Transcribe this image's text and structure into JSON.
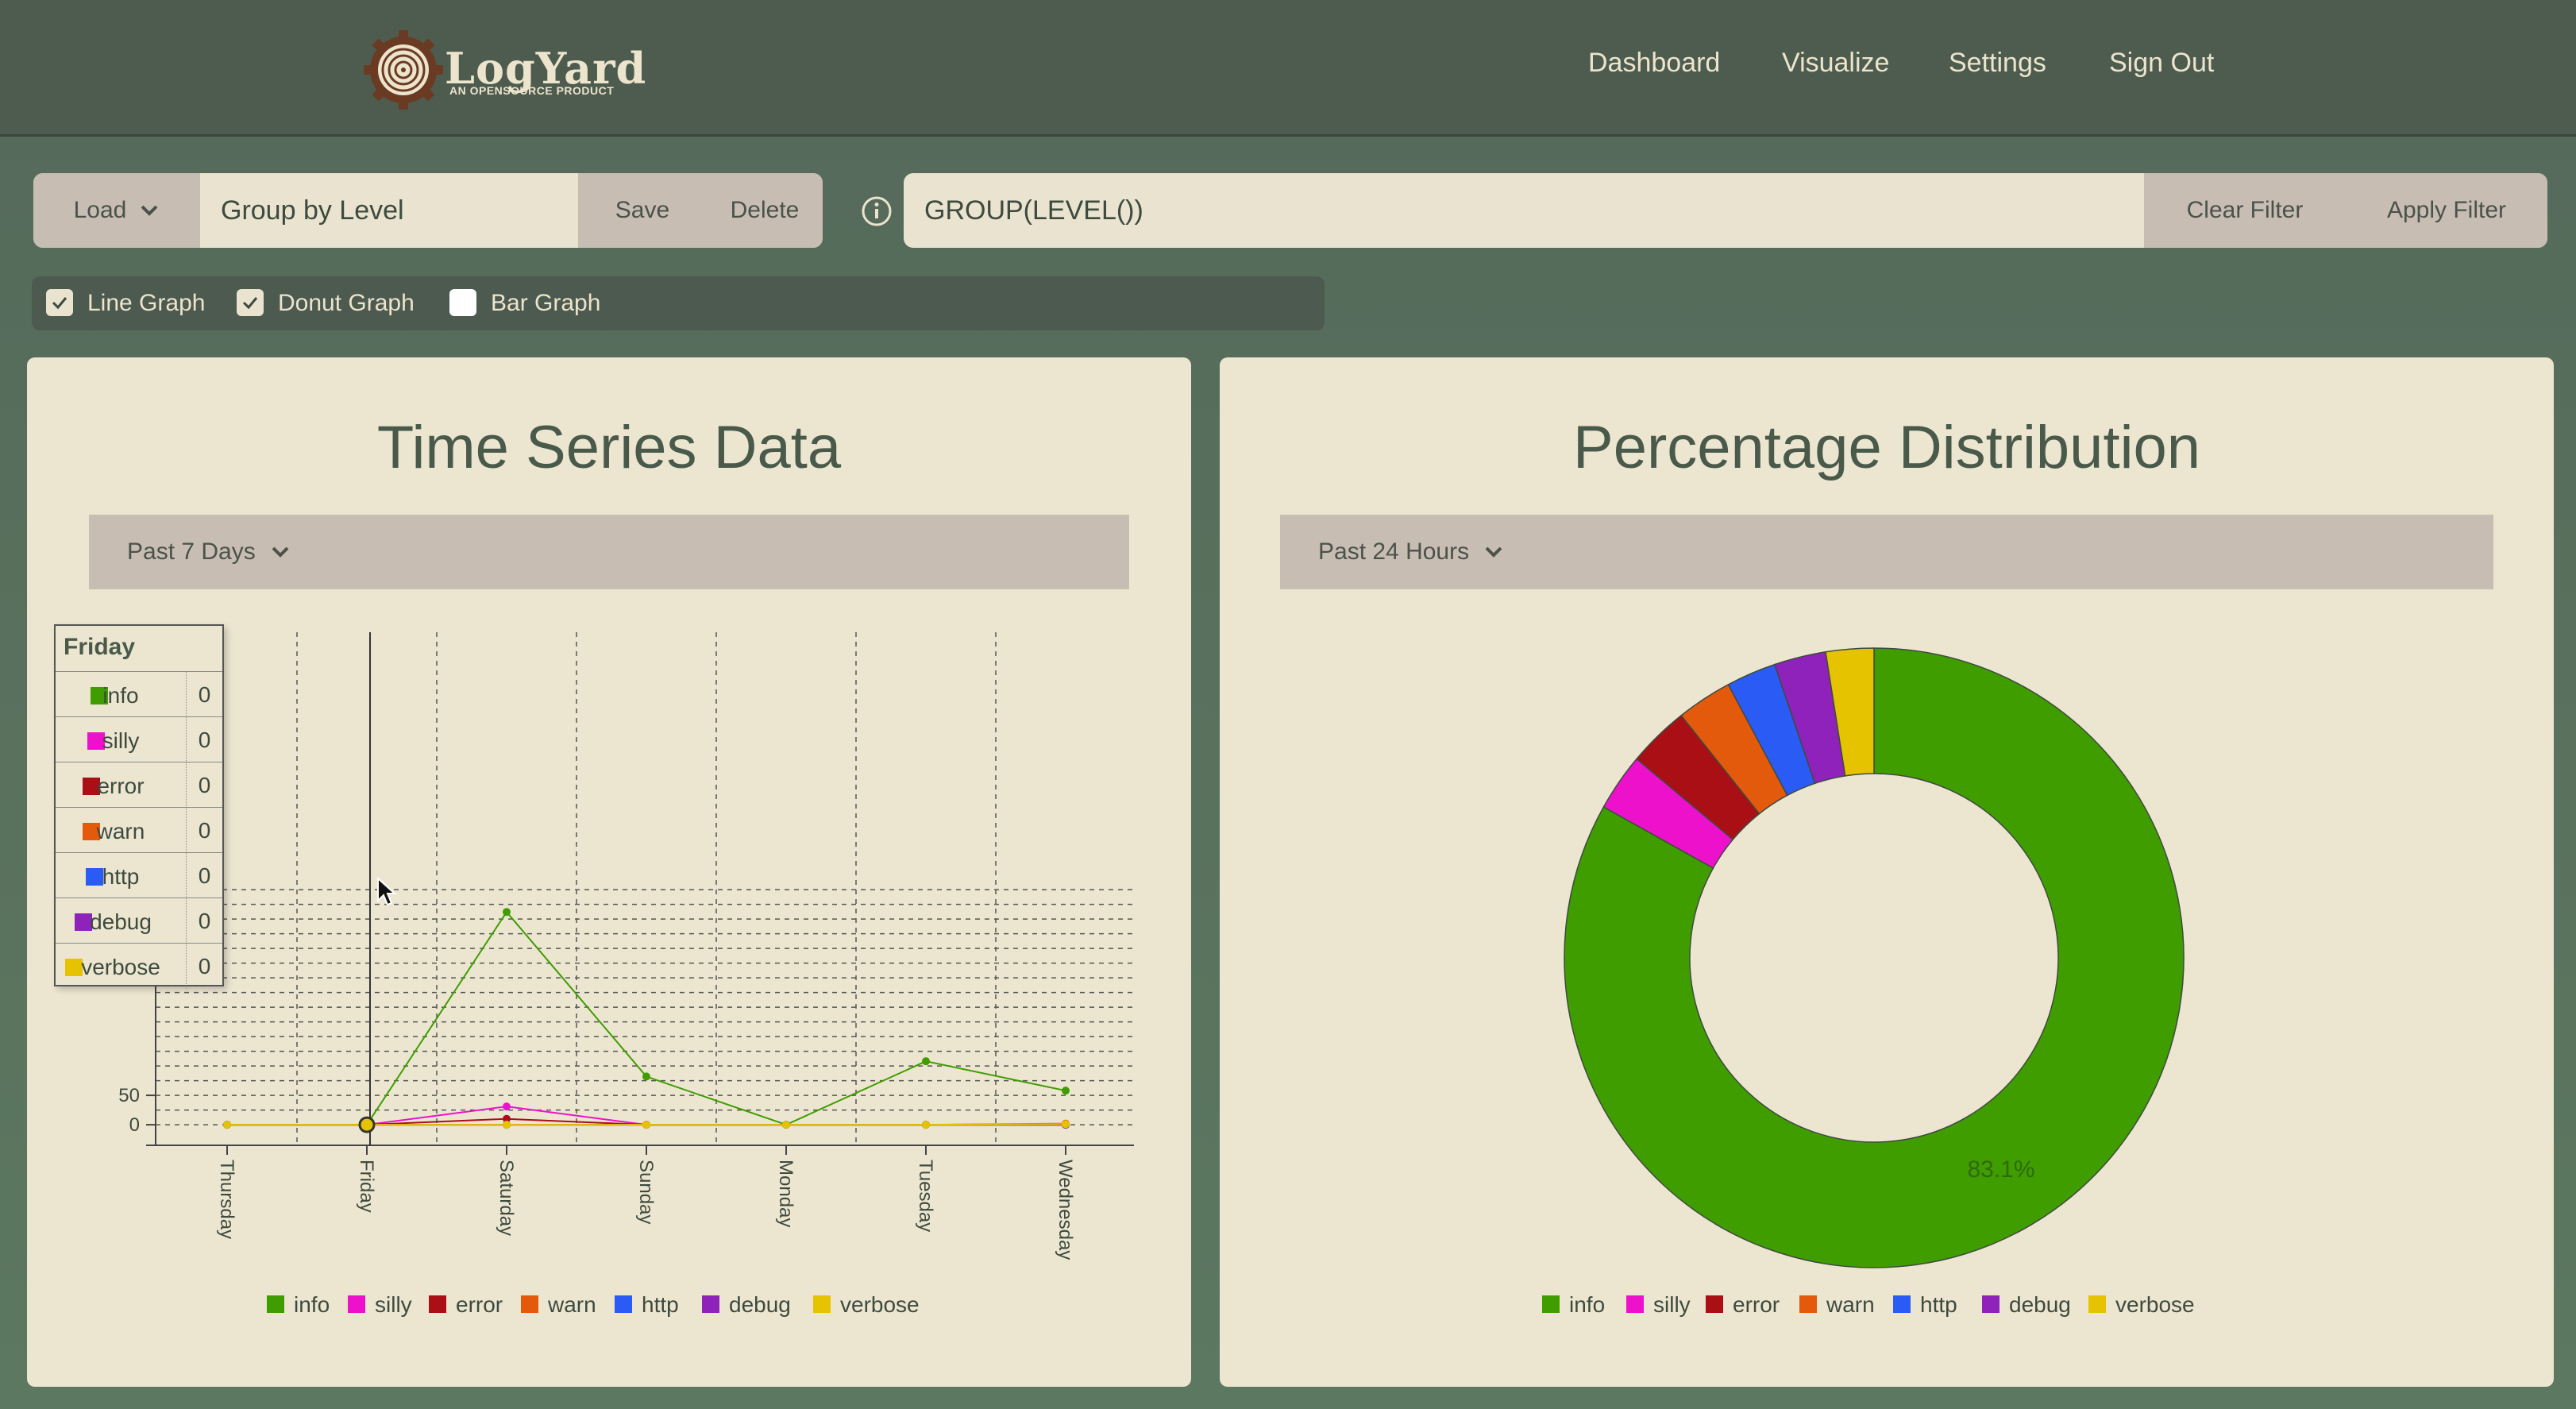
{
  "header": {
    "logo_text": "LogYard",
    "logo_sub": "AN OPENSOURCE PRODUCT",
    "nav": [
      "Dashboard",
      "Visualize",
      "Settings",
      "Sign Out"
    ]
  },
  "query_bar": {
    "load_label": "Load",
    "query_name": "Group by Level",
    "save_label": "Save",
    "delete_label": "Delete"
  },
  "filter_bar": {
    "filter_text": "GROUP(LEVEL())",
    "clear_label": "Clear Filter",
    "apply_label": "Apply Filter"
  },
  "graph_toggles": [
    {
      "label": "Line Graph",
      "checked": true
    },
    {
      "label": "Donut Graph",
      "checked": true
    },
    {
      "label": "Bar Graph",
      "checked": false
    }
  ],
  "colors": {
    "info": "#3f9d00",
    "silly": "#ee11cc",
    "error": "#aa0f16",
    "warn": "#e35a0c",
    "http": "#2a5cf5",
    "debug": "#8e22bb",
    "verbose": "#e6c300"
  },
  "line_panel": {
    "title": "Time Series Data",
    "range": "Past 7 Days",
    "tooltip": {
      "header": "Friday",
      "rows": [
        {
          "label": "info",
          "value": "0"
        },
        {
          "label": "silly",
          "value": "0"
        },
        {
          "label": "error",
          "value": "0"
        },
        {
          "label": "warn",
          "value": "0"
        },
        {
          "label": "http",
          "value": "0"
        },
        {
          "label": "debug",
          "value": "0"
        },
        {
          "label": "verbose",
          "value": "0"
        }
      ]
    }
  },
  "donut_panel": {
    "title": "Percentage Distribution",
    "range": "Past 24 Hours"
  },
  "chart_data": [
    {
      "type": "line",
      "x": [
        "Thursday",
        "Friday",
        "Saturday",
        "Sunday",
        "Monday",
        "Tuesday",
        "Wednesday"
      ],
      "y_ticks": [
        0,
        50
      ],
      "ylim": [
        -35,
        400
      ],
      "grid": true,
      "legend": "bottom",
      "series": [
        {
          "name": "info",
          "values": [
            0,
            0,
            362,
            82,
            0,
            108,
            58
          ]
        },
        {
          "name": "silly",
          "values": [
            0,
            0,
            31,
            0,
            0,
            0,
            0
          ]
        },
        {
          "name": "error",
          "values": [
            0,
            0,
            10,
            0,
            0,
            0,
            0
          ]
        },
        {
          "name": "warn",
          "values": [
            0,
            0,
            0,
            0,
            0,
            0,
            2
          ]
        },
        {
          "name": "http",
          "values": [
            0,
            0,
            0,
            0,
            0,
            0,
            0
          ]
        },
        {
          "name": "debug",
          "values": [
            0,
            0,
            0,
            0,
            0,
            0,
            0
          ]
        },
        {
          "name": "verbose",
          "values": [
            0,
            0,
            0,
            0,
            0,
            0,
            1
          ]
        }
      ]
    },
    {
      "type": "pie",
      "donut": true,
      "legend": "bottom",
      "labels": [
        "info",
        "silly",
        "error",
        "warn",
        "http",
        "debug",
        "verbose"
      ],
      "values": [
        83.1,
        3.0,
        3.2,
        2.9,
        2.6,
        2.7,
        2.5
      ],
      "slice_label": "83.1%"
    }
  ]
}
